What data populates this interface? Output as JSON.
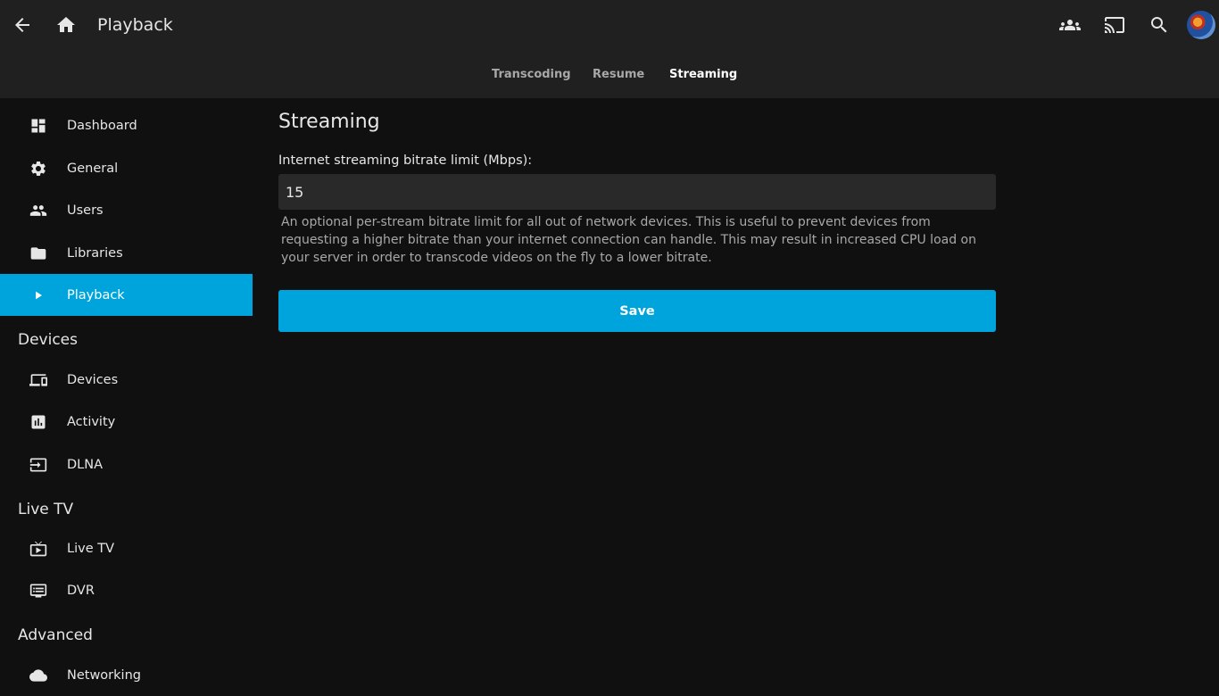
{
  "header": {
    "title": "Playback",
    "icons": [
      "back-arrow-icon",
      "home-icon",
      "users-group-icon",
      "cast-icon",
      "search-icon"
    ],
    "tabs": [
      {
        "label": "Transcoding",
        "active": false
      },
      {
        "label": "Resume",
        "active": false
      },
      {
        "label": "Streaming",
        "active": true
      }
    ]
  },
  "sidebar": {
    "server_items": [
      {
        "label": "Dashboard",
        "icon": "dashboard-icon"
      },
      {
        "label": "General",
        "icon": "gear-icon"
      },
      {
        "label": "Users",
        "icon": "people-icon"
      },
      {
        "label": "Libraries",
        "icon": "folder-icon"
      },
      {
        "label": "Playback",
        "icon": "play-icon",
        "active": true
      }
    ],
    "devices_header": "Devices",
    "devices_items": [
      {
        "label": "Devices",
        "icon": "devices-icon"
      },
      {
        "label": "Activity",
        "icon": "activity-icon"
      },
      {
        "label": "DLNA",
        "icon": "input-icon"
      }
    ],
    "livetv_header": "Live TV",
    "livetv_items": [
      {
        "label": "Live TV",
        "icon": "live-tv-icon"
      },
      {
        "label": "DVR",
        "icon": "dvr-icon"
      }
    ],
    "advanced_header": "Advanced",
    "advanced_items": [
      {
        "label": "Networking",
        "icon": "cloud-icon"
      }
    ]
  },
  "main": {
    "title": "Streaming",
    "field_label": "Internet streaming bitrate limit (Mbps):",
    "field_value": "15",
    "field_description": "An optional per-stream bitrate limit for all out of network devices. This is useful to prevent devices from requesting a higher bitrate than your internet connection can handle. This may result in increased CPU load on your server in order to transcode videos on the fly to a lower bitrate.",
    "save_label": "Save"
  },
  "colors": {
    "accent": "#00a4dc",
    "header_bg": "#202020",
    "page_bg": "#101010",
    "input_bg": "#292929"
  }
}
